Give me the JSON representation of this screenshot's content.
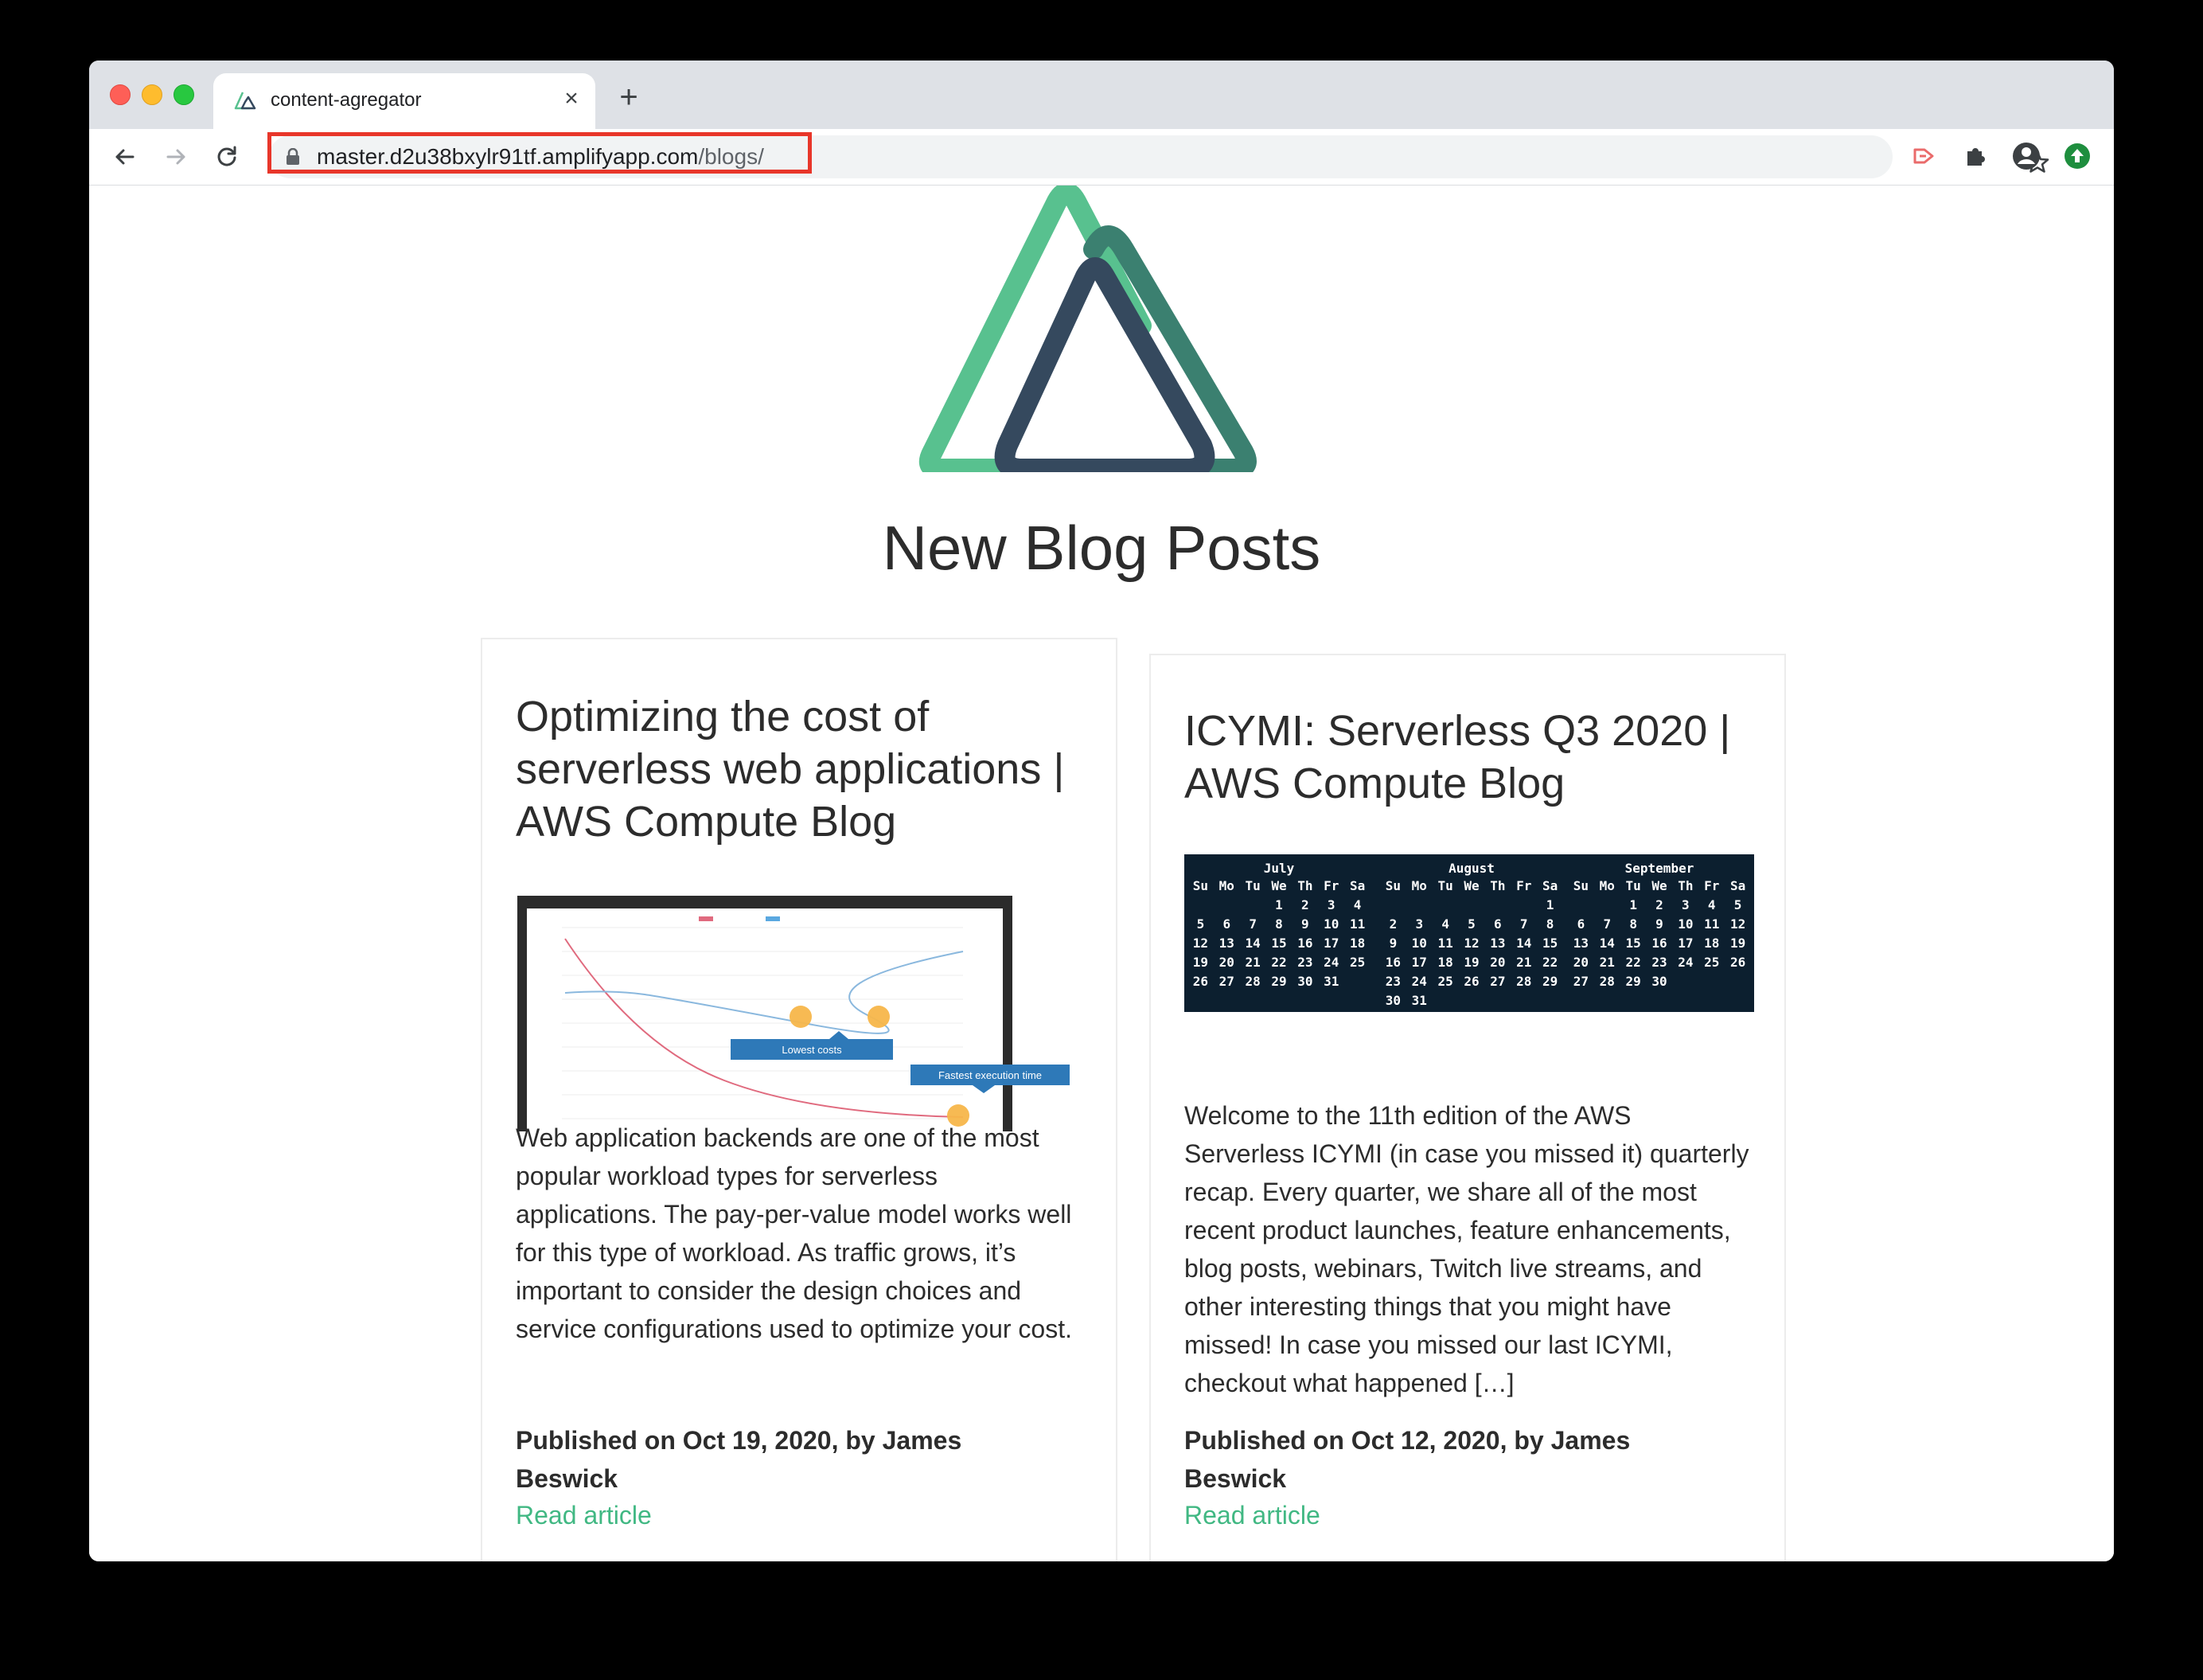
{
  "browser": {
    "tab_title": "content-agregator",
    "url_host": "master.d2u38bxylr91tf.amplifyapp.com",
    "url_path": "/blogs/"
  },
  "page": {
    "title": "New Blog Posts"
  },
  "posts": [
    {
      "title": "Optimizing the cost of serverless web applications | AWS Compute Blog",
      "excerpt": "Web application backends are one of the most popular workload types for serverless applications. The pay-per-value model works well for this type of workload. As traffic grows, it’s important to consider the design choices and service configurations used to optimize your cost.",
      "meta": "Published on Oct 19, 2020, by James Beswick",
      "link_label": "Read article",
      "image": {
        "callout_low": "Lowest costs",
        "callout_fast": "Fastest execution time"
      }
    },
    {
      "title": "ICYMI: Serverless Q3 2020 | AWS Compute Blog",
      "excerpt": "Welcome to the 11th edition of the AWS Serverless ICYMI (in case you missed it) quarterly recap. Every quarter, we share all of the most recent product launches, feature enhancements, blog posts, webinars, Twitch live streams, and other interesting things that you might have missed! In case you missed our last ICYMI, checkout what happened […]",
      "meta": "Published on Oct 12, 2020, by James Beswick",
      "link_label": "Read article",
      "calendar": {
        "weekdays": [
          "Su",
          "Mo",
          "Tu",
          "We",
          "Th",
          "Fr",
          "Sa"
        ],
        "months": [
          {
            "name": "July",
            "cells": [
              "",
              "",
              "",
              "1",
              "2",
              "3",
              "4",
              "5",
              "6",
              "7",
              "8",
              "9",
              "10",
              "11",
              "12",
              "13",
              "14",
              "15",
              "16",
              "17",
              "18",
              "19",
              "20",
              "21",
              "22",
              "23",
              "24",
              "25",
              "26",
              "27",
              "28",
              "29",
              "30",
              "31"
            ]
          },
          {
            "name": "August",
            "cells": [
              "",
              "",
              "",
              "",
              "",
              "",
              "1",
              "2",
              "3",
              "4",
              "5",
              "6",
              "7",
              "8",
              "9",
              "10",
              "11",
              "12",
              "13",
              "14",
              "15",
              "16",
              "17",
              "18",
              "19",
              "20",
              "21",
              "22",
              "23",
              "24",
              "25",
              "26",
              "27",
              "28",
              "29",
              "30",
              "31"
            ]
          },
          {
            "name": "September",
            "cells": [
              "",
              "",
              "1",
              "2",
              "3",
              "4",
              "5",
              "6",
              "7",
              "8",
              "9",
              "10",
              "11",
              "12",
              "13",
              "14",
              "15",
              "16",
              "17",
              "18",
              "19",
              "20",
              "21",
              "22",
              "23",
              "24",
              "25",
              "26",
              "27",
              "28",
              "29",
              "30"
            ]
          }
        ]
      }
    }
  ],
  "colors": {
    "accent": "#41b883",
    "logo_light": "#58c18f",
    "logo_mid": "#3b8070",
    "logo_dark": "#35495e",
    "url_highlight": "#e8362a"
  }
}
